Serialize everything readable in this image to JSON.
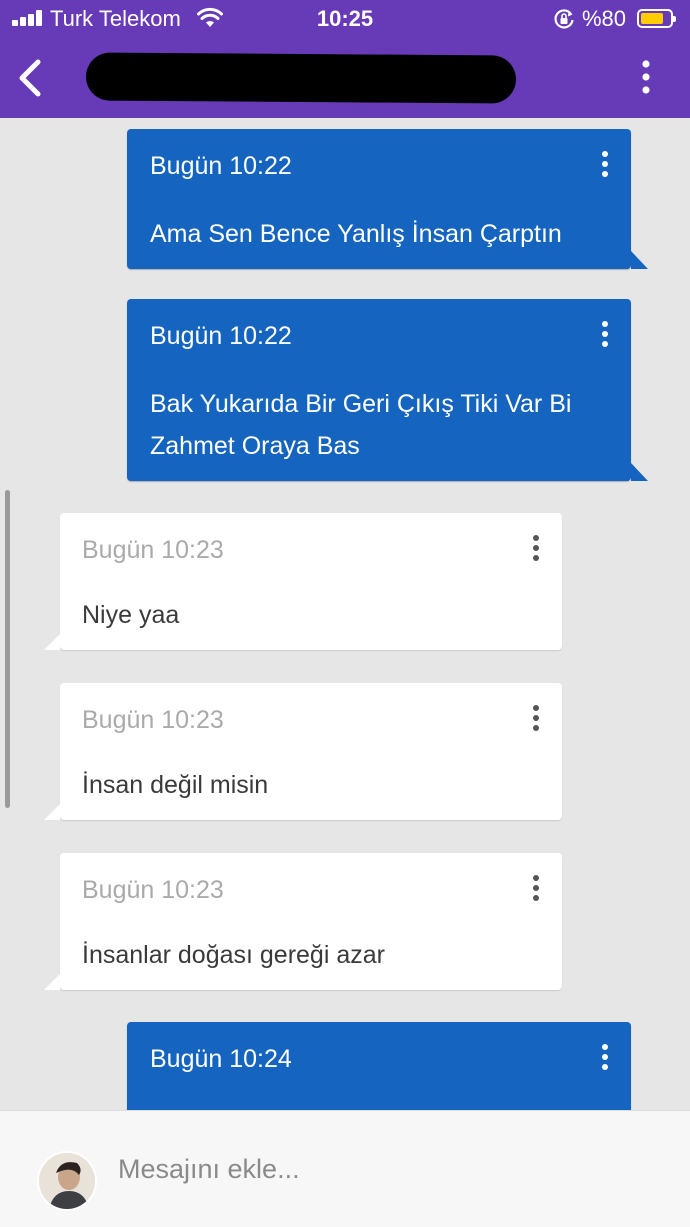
{
  "status_bar": {
    "carrier": "Turk Telekom",
    "time": "10:25",
    "battery": "%80",
    "battery_level": 0.8,
    "icons": [
      "signal-icon",
      "wifi-icon",
      "orientation-lock-icon",
      "battery-icon"
    ]
  },
  "header": {
    "back_icon": "chevron-left-icon",
    "menu_icon": "more-vertical-icon",
    "background": "#673ab7"
  },
  "messages": [
    {
      "direction": "outgoing",
      "timestamp": "Bugün 10:22",
      "text": "Ama Sen Bence Yanlış İnsan Çarptın"
    },
    {
      "direction": "outgoing",
      "timestamp": "Bugün 10:22",
      "text": "Bak Yukarıda Bir Geri Çıkış Tiki Var Bi Zahmet Oraya Bas"
    },
    {
      "direction": "incoming",
      "timestamp": "Bugün 10:23",
      "text": "Niye yaa"
    },
    {
      "direction": "incoming",
      "timestamp": "Bugün 10:23",
      "text": "İnsan değil misin"
    },
    {
      "direction": "incoming",
      "timestamp": "Bugün 10:23",
      "text": "İnsanlar doğası gereği azar"
    },
    {
      "direction": "outgoing",
      "timestamp": "Bugün 10:24",
      "text": ""
    }
  ],
  "composer": {
    "placeholder": "Mesajını ekle...",
    "value": ""
  },
  "colors": {
    "outgoing_bubble": "#1565c0",
    "incoming_bubble": "#ffffff",
    "chat_background": "#e6e6e6"
  }
}
